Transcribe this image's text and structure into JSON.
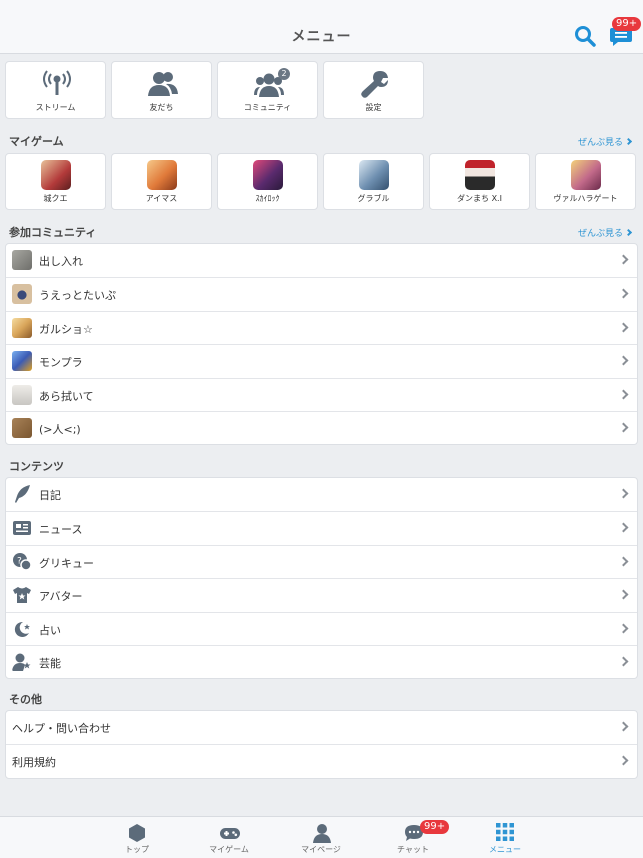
{
  "header": {
    "title": "メニュー",
    "chat_badge": "99+"
  },
  "quick_actions": [
    {
      "label": "ストリーム",
      "icon": "broadcast-icon"
    },
    {
      "label": "友だち",
      "icon": "friends-icon"
    },
    {
      "label": "コミュニティ",
      "icon": "community-icon",
      "badge": "2"
    },
    {
      "label": "設定",
      "icon": "wrench-icon"
    }
  ],
  "my_games": {
    "title": "マイゲーム",
    "see_all": "ぜんぶ見る",
    "items": [
      {
        "label": "城クエ",
        "color": "#b33a3a"
      },
      {
        "label": "アイマス",
        "color": "#e07a3a"
      },
      {
        "label": "ｽｶｲﾛｯｸ",
        "color": "#5a2a6e"
      },
      {
        "label": "グラブル",
        "color": "#6e8fb0"
      },
      {
        "label": "ダンまち X.I",
        "color": "#2a2a2a"
      },
      {
        "label": "ヴァルハラゲート",
        "color": "#c26a8a"
      }
    ]
  },
  "communities": {
    "title": "参加コミュニティ",
    "see_all": "ぜんぶ見る",
    "items": [
      {
        "label": "出し入れ",
        "color": "#8a8a86"
      },
      {
        "label": "うえっとたいぷ",
        "color": "#b79a7a"
      },
      {
        "label": "ガルショ☆",
        "color": "#d9a55a"
      },
      {
        "label": "モンプラ",
        "color": "#3b5bb5"
      },
      {
        "label": "あら拭いて",
        "color": "#d8d6d2"
      },
      {
        "label": "(>人<;)",
        "color": "#8e6a43"
      }
    ]
  },
  "contents": {
    "title": "コンテンツ",
    "items": [
      {
        "label": "日記",
        "icon": "feather-icon"
      },
      {
        "label": "ニュース",
        "icon": "newspaper-icon"
      },
      {
        "label": "グリキュー",
        "icon": "qa-icon"
      },
      {
        "label": "アバター",
        "icon": "tshirt-icon"
      },
      {
        "label": "占い",
        "icon": "moon-star-icon"
      },
      {
        "label": "芸能",
        "icon": "person-star-icon"
      }
    ]
  },
  "other": {
    "title": "その他",
    "items": [
      {
        "label": "ヘルプ・問い合わせ"
      },
      {
        "label": "利用規約"
      }
    ]
  },
  "tabbar": {
    "chat_badge": "99+",
    "items": [
      {
        "label": "トップ",
        "icon": "hexagon-icon"
      },
      {
        "label": "マイゲーム",
        "icon": "gamepad-icon"
      },
      {
        "label": "マイページ",
        "icon": "person-icon"
      },
      {
        "label": "チャット",
        "icon": "chat-icon"
      },
      {
        "label": "メニュー",
        "icon": "grid-icon",
        "active": true
      }
    ]
  },
  "colors": {
    "accent": "#2f95d3",
    "badge": "#e8383d",
    "icon": "#5c6b7a"
  }
}
